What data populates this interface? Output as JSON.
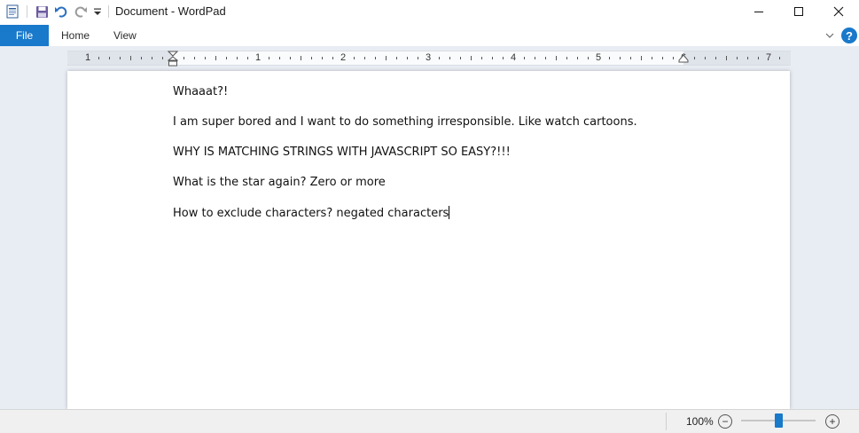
{
  "window": {
    "title": "Document - WordPad"
  },
  "quick_access": {
    "icons": [
      "wordpad-app-icon",
      "save-icon",
      "undo-icon",
      "redo-icon",
      "customize-qat-icon"
    ]
  },
  "window_controls": {
    "minimize": "–",
    "maximize": "☐",
    "close": "✕"
  },
  "ribbon": {
    "file_tab": "File",
    "tabs": [
      {
        "label": "Home"
      },
      {
        "label": "View"
      }
    ],
    "help": "?"
  },
  "ruler": {
    "numbers": [
      "1",
      "1",
      "2",
      "3",
      "4",
      "5",
      "6",
      "7"
    ]
  },
  "document": {
    "paragraphs": [
      "Whaaat?!",
      "I am super bored and I want to do something irresponsible. Like watch cartoons.",
      "WHY IS MATCHING STRINGS WITH JAVASCRIPT SO EASY?!!!",
      "What is the star again? Zero or more",
      "How to exclude characters? negated characters"
    ]
  },
  "status": {
    "zoom_level": "100%",
    "zoom_out": "−",
    "zoom_in": "+",
    "zoom_fraction": 0.5
  },
  "colors": {
    "accent": "#1979ca",
    "workspace": "#e8ecf3"
  }
}
